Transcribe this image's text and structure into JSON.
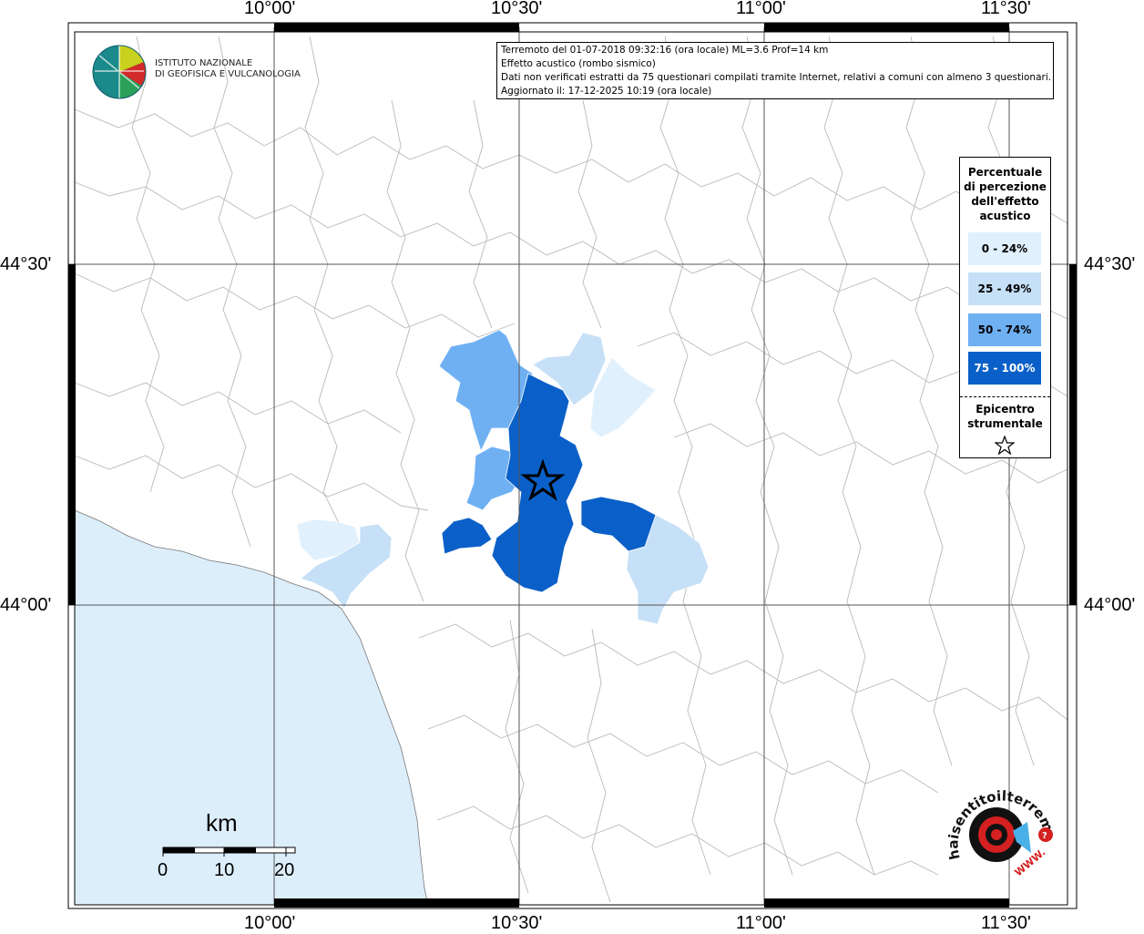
{
  "info": {
    "line1": "Terremoto del 01-07-2018 09:32:16 (ora locale) ML=3.6 Prof=14 km",
    "line2": "Effetto acustico (rombo sismico)",
    "line3": "Dati non verificati estratti da 75 questionari compilati tramite Internet, relativi a comuni con almeno 3 questionari.",
    "line4": "Aggiornato il: 17-12-2025 10:19 (ora locale)"
  },
  "ingv": {
    "line1": "ISTITUTO NAZIONALE",
    "line2": "DI GEOFISICA E VULCANOLOGIA"
  },
  "axes": {
    "lon": [
      "10°00'",
      "10°30'",
      "11°00'",
      "11°30'"
    ],
    "lat": [
      "44°30'",
      "44°00'"
    ]
  },
  "legend": {
    "title_1": "Percentuale",
    "title_2": "di percezione",
    "title_3": "dell'effetto",
    "title_4": "acustico",
    "classes": [
      {
        "label": "0 - 24%",
        "color": "#e0f0fc"
      },
      {
        "label": "25 - 49%",
        "color": "#c6e0f7"
      },
      {
        "label": "50 - 74%",
        "color": "#6fb0f3"
      },
      {
        "label": "75 - 100%",
        "color": "#0a60c8"
      }
    ],
    "epicentre_1": "Epicentro",
    "epicentre_2": "strumentale"
  },
  "scale": {
    "unit": "km",
    "ticks": [
      "0",
      "10",
      "20"
    ]
  },
  "colors": {
    "sea": "#ddeefb",
    "grid": "#555555",
    "border": "#b5b5b5"
  },
  "hst": {
    "text": "haisentitoilterremoto.it",
    "www": "WWW."
  }
}
